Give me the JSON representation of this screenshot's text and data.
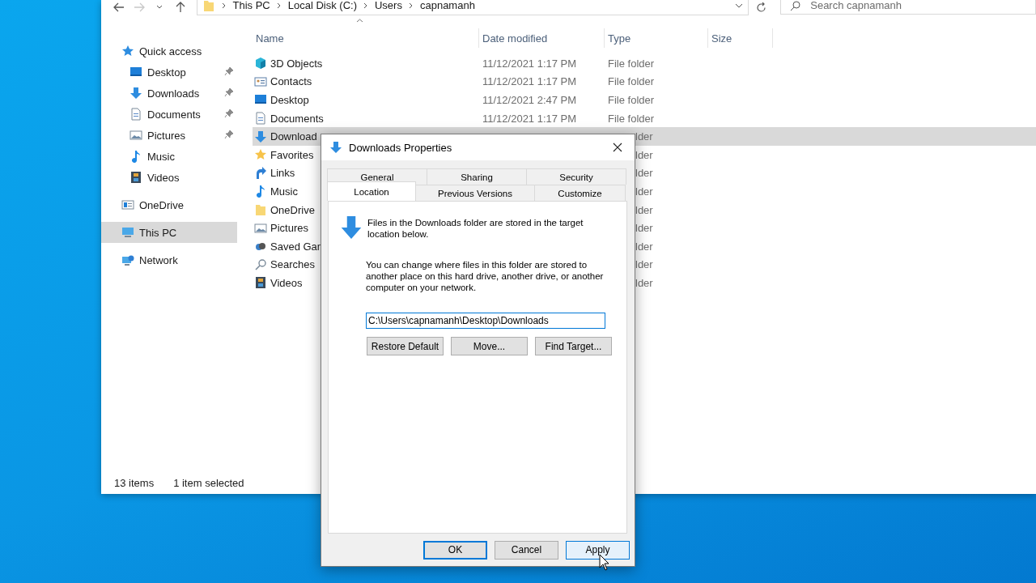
{
  "explorer": {
    "nav": {
      "breadcrumb": [
        "This PC",
        "Local Disk (C:)",
        "Users",
        "capnamanh"
      ],
      "search": {
        "placeholder": "Search capnamanh"
      }
    },
    "sidebar": {
      "items": [
        {
          "label": "Quick access",
          "selected": false,
          "children": [
            {
              "label": "Desktop",
              "pinned": true,
              "selected": false
            },
            {
              "label": "Downloads",
              "pinned": true,
              "selected": false
            },
            {
              "label": "Documents",
              "pinned": true,
              "selected": false
            },
            {
              "label": "Pictures",
              "pinned": true,
              "selected": false
            },
            {
              "label": "Music",
              "pinned": false,
              "selected": false
            },
            {
              "label": "Videos",
              "pinned": false,
              "selected": false
            }
          ]
        },
        {
          "label": "OneDrive",
          "selected": false
        },
        {
          "label": "This PC",
          "selected": true
        },
        {
          "label": "Network",
          "selected": false
        }
      ]
    },
    "columns": [
      "Name",
      "Date modified",
      "Type",
      "Size"
    ],
    "rows": [
      {
        "name": "3D Objects",
        "date": "11/12/2021 1:17 PM",
        "type": "File folder",
        "selected": false
      },
      {
        "name": "Contacts",
        "date": "11/12/2021 1:17 PM",
        "type": "File folder",
        "selected": false
      },
      {
        "name": "Desktop",
        "date": "11/12/2021 2:47 PM",
        "type": "File folder",
        "selected": false
      },
      {
        "name": "Documents",
        "date": "11/12/2021 1:17 PM",
        "type": "File folder",
        "selected": false
      },
      {
        "name": "Download",
        "type": "lder",
        "selected": true
      },
      {
        "name": "Favorites",
        "type": "lder",
        "selected": false
      },
      {
        "name": "Links",
        "type": "lder",
        "selected": false
      },
      {
        "name": "Music",
        "type": "lder",
        "selected": false
      },
      {
        "name": "OneDrive",
        "type": "lder",
        "selected": false
      },
      {
        "name": "Pictures",
        "type": "lder",
        "selected": false
      },
      {
        "name": "Saved Gan",
        "type": "lder",
        "selected": false
      },
      {
        "name": "Searches",
        "type": "lder",
        "selected": false
      },
      {
        "name": "Videos",
        "type": "lder",
        "selected": false
      }
    ],
    "status_bar": [
      "13 items",
      "1 item selected"
    ]
  },
  "dialog": {
    "title": "Downloads Properties",
    "tab_rows": [
      {
        "tabs": [
          {
            "label": "General",
            "selected": false
          },
          {
            "label": "Sharing",
            "selected": false
          },
          {
            "label": "Security",
            "selected": false
          }
        ]
      },
      {
        "tabs": [
          {
            "label": "Location",
            "selected": true
          },
          {
            "label": "Previous Versions",
            "selected": false
          },
          {
            "label": "Customize",
            "selected": false
          }
        ]
      }
    ],
    "message": "Files in the Downloads folder are stored in the target location below.",
    "description": "You can change where files in this folder are stored to another place on this hard drive, another drive, or another computer on your network.",
    "path": "C:\\Users\\capnamanh\\Desktop\\Downloads",
    "actions": [
      "Restore Default",
      "Move...",
      "Find Target..."
    ],
    "buttons": [
      {
        "label": "OK",
        "default": true,
        "hovered": false
      },
      {
        "label": "Cancel",
        "default": false,
        "hovered": false
      },
      {
        "label": "Apply",
        "default": false,
        "hovered": true
      }
    ]
  }
}
